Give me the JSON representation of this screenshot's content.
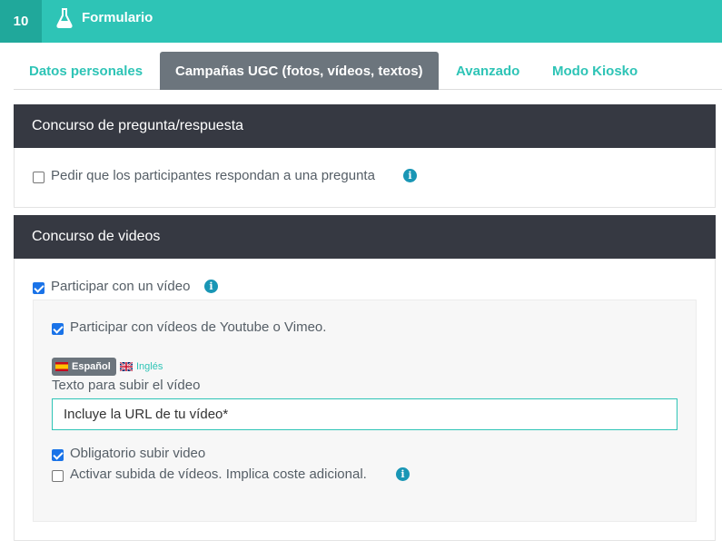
{
  "topbar": {
    "step": "10",
    "icon": "flask-icon",
    "title": "Formulario",
    "color": "#2ec4b6"
  },
  "tabs": [
    {
      "label": "Datos personales",
      "active": false
    },
    {
      "label": "Campañas UGC (fotos, vídeos, textos)",
      "active": true
    },
    {
      "label": "Avanzado",
      "active": false
    },
    {
      "label": "Modo Kiosko",
      "active": false
    }
  ],
  "qa_section": {
    "title": "Concurso de pregunta/respuesta",
    "ask_question": {
      "label": "Pedir que los participantes respondan a una pregunta",
      "checked": false
    }
  },
  "video_section": {
    "title": "Concurso de videos",
    "participate_video": {
      "label": "Participar con un vídeo",
      "checked": true
    },
    "youtube_vimeo": {
      "label": "Participar con vídeos de Youtube o Vimeo.",
      "checked": true
    },
    "languages": {
      "spanish": "Español",
      "english": "Inglés"
    },
    "upload_text": {
      "label": "Texto para subir el vídeo",
      "value": "Incluye la URL de tu vídeo*"
    },
    "required_upload": {
      "label": "Obligatorio subir video",
      "checked": true
    },
    "enable_upload": {
      "label": "Activar subida de vídeos. Implica coste adicional.",
      "checked": false
    }
  }
}
